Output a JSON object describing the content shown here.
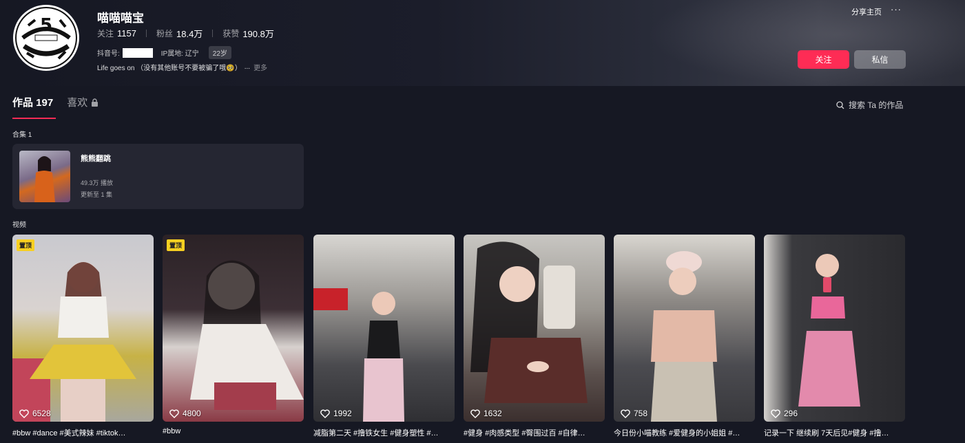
{
  "profile": {
    "name": "喵喵喵宝",
    "stats": [
      {
        "label": "关注",
        "value": "1157"
      },
      {
        "label": "粉丝",
        "value": "18.4万"
      },
      {
        "label": "获赞",
        "value": "190.8万"
      }
    ],
    "douyin_id_label": "抖音号:",
    "ip_label": "IP属地: 辽宁",
    "age": "22岁",
    "bio": "Life goes on （没有其他账号不要被骗了哦🥺）",
    "bio_ellipsis": "...",
    "bio_more": "更多"
  },
  "header_actions": {
    "share": "分享主页",
    "more": "···",
    "follow": "关注",
    "message": "私信"
  },
  "tabs": {
    "works": "作品 197",
    "likes": "喜欢"
  },
  "search": {
    "label": "搜索 Ta 的作品"
  },
  "collections": {
    "section_label": "合集 1",
    "items": [
      {
        "title": "熊熊翻跳",
        "plays": "49.3万 播放",
        "updated": "更新至 1 集"
      }
    ]
  },
  "videos": {
    "section_label": "视频",
    "items": [
      {
        "pinned": "置顶",
        "likes": "6528",
        "desc": "#bbw #dance #美式辣妹 #tiktok…"
      },
      {
        "pinned": "置顶",
        "likes": "4800",
        "desc": "#bbw"
      },
      {
        "pinned": "",
        "likes": "1992",
        "desc": "减脂第二天 #撸铁女生 #健身塑性 #…"
      },
      {
        "pinned": "",
        "likes": "1632",
        "desc": "#健身 #肉感类型 #臀围过百 #自律…"
      },
      {
        "pinned": "",
        "likes": "758",
        "desc": "今日份小喵教练 #爱健身的小姐姐 #…"
      },
      {
        "pinned": "",
        "likes": "296",
        "desc": "记录一下 继续刷 7天后见#健身 #撸…"
      }
    ]
  },
  "colors": {
    "background": "#161823",
    "accent": "#fe2c55",
    "card": "#252632",
    "pin_badge": "#f8d021"
  }
}
